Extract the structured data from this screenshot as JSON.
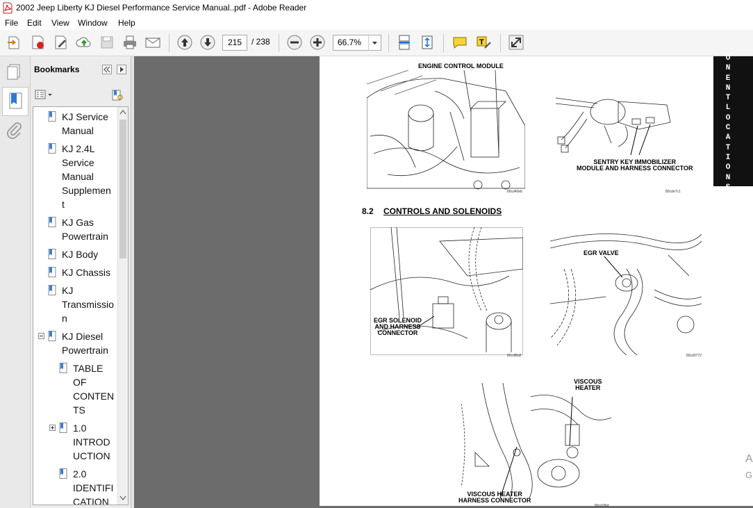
{
  "window": {
    "title": "2002 Jeep Liberty KJ Diesel Performance Service Manual..pdf - Adobe Reader"
  },
  "menubar": {
    "items": [
      "File",
      "Edit",
      "View",
      "Window",
      "Help"
    ]
  },
  "toolbar": {
    "current_page": "215",
    "page_total": "/ 238",
    "zoom": "66.7%"
  },
  "bookmarks": {
    "title": "Bookmarks",
    "items": [
      "KJ Service Manual",
      "KJ 2.4L Service Manual Supplement",
      "KJ Gas Powertrain",
      "KJ Body",
      "KJ Chassis",
      "KJ Transmission",
      "KJ Diesel Powertrain",
      "TABLE OF CONTENTS",
      "1.0 INTRODUCTION",
      "2.0 IDENTIFICATION"
    ],
    "wrapped": [
      [
        "KJ Service",
        "Manual"
      ],
      [
        "KJ 2.4L",
        "Service",
        "Manual",
        "Supplemen",
        "t"
      ],
      [
        "KJ Gas",
        "Powertrain"
      ],
      [
        "KJ Body"
      ],
      [
        "KJ Chassis"
      ],
      [
        "KJ",
        "Transmissio",
        "n"
      ],
      [
        "KJ Diesel",
        "Powertrain"
      ],
      [
        "TABLE",
        "OF",
        "CONTEN",
        "TS"
      ],
      [
        "1.0",
        "INTROD",
        "UCTION"
      ],
      [
        "2.0",
        "IDENTIFI",
        "CATION"
      ]
    ]
  },
  "document": {
    "side_tab": "ONENT LOCATIONS",
    "section_number": "8.2",
    "section_title": "CONTROLS AND SOLENOIDS",
    "callouts": {
      "ecm": "ENGINE CONTROL MODULE",
      "skim": "SENTRY KEY IMMOBILIZER\nMODULE AND HARNESS CONNECTOR",
      "egr_solenoid": "EGR SOLENOID\nAND HARNESS\nCONNECTOR",
      "egr_valve": "EGR VALVE",
      "viscous_heater": "VISCOUS\nHEATER",
      "viscous_connector": "VISCOUS HEATER\nHARNESS CONNECTOR"
    },
    "figure_codes": [
      "80cd40eb",
      "80cde7c1",
      "80cdf8a6",
      "80cd0772",
      "80cd1f6d"
    ]
  },
  "watermark": [
    "A",
    "G"
  ]
}
